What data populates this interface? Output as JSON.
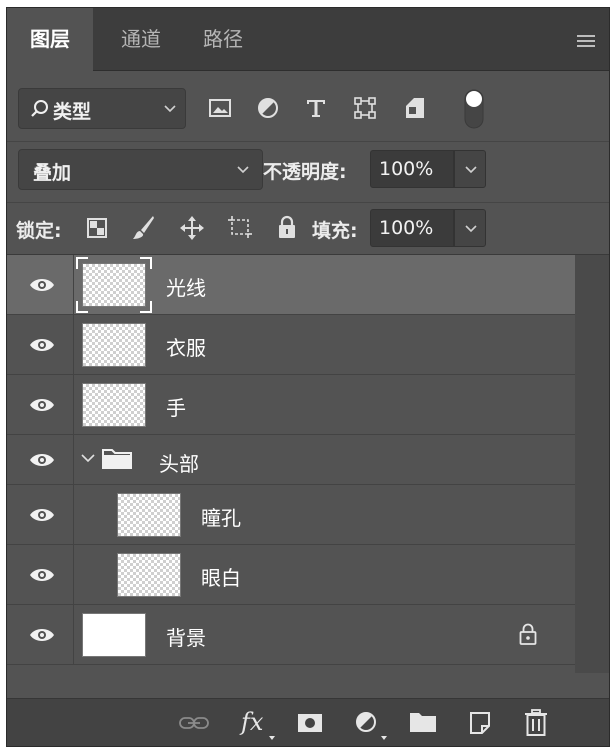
{
  "tabs": [
    {
      "label": "图层",
      "active": true
    },
    {
      "label": "通道",
      "active": false
    },
    {
      "label": "路径",
      "active": false
    }
  ],
  "filter": {
    "kind_label": "类型"
  },
  "blend": {
    "mode": "叠加",
    "opacity_label": "不透明度:",
    "opacity_value": "100%"
  },
  "lock": {
    "lock_label": "锁定:",
    "fill_label": "填充:",
    "fill_value": "100%"
  },
  "layers": [
    {
      "name": "光线",
      "selected": true,
      "visible": true,
      "indent": 0
    },
    {
      "name": "衣服",
      "selected": false,
      "visible": true,
      "indent": 0
    },
    {
      "name": "手",
      "selected": false,
      "visible": true,
      "indent": 0
    },
    {
      "name": "头部",
      "type": "group",
      "expanded": true,
      "visible": true
    },
    {
      "name": "瞳孔",
      "selected": false,
      "visible": true,
      "indent": 1
    },
    {
      "name": "眼白",
      "selected": false,
      "visible": true,
      "indent": 1
    },
    {
      "name": "背景",
      "selected": false,
      "visible": true,
      "locked": true,
      "fill": "white"
    }
  ],
  "footer": {
    "fx_label": "fx",
    "icons": [
      "link-icon",
      "fx-icon",
      "mask-icon",
      "adjustment-icon",
      "folder-icon",
      "new-layer-icon",
      "trash-icon"
    ]
  },
  "colors": {
    "panel": "#535353",
    "tabbar": "#3d3d3d",
    "selected_row": "#6a6a6a",
    "footer": "#434343"
  }
}
